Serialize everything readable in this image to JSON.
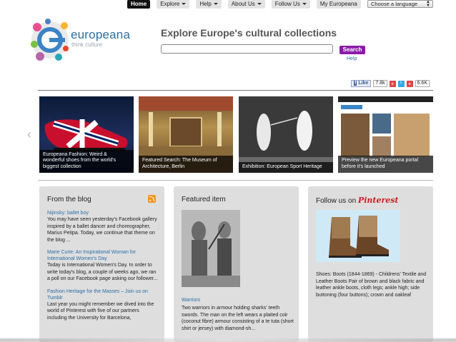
{
  "nav": {
    "items": [
      {
        "label": "Home",
        "active": true,
        "dropdown": false
      },
      {
        "label": "Explore",
        "active": false,
        "dropdown": true
      },
      {
        "label": "Help",
        "active": false,
        "dropdown": true
      },
      {
        "label": "About Us",
        "active": false,
        "dropdown": true
      },
      {
        "label": "Follow Us",
        "active": false,
        "dropdown": true
      },
      {
        "label": "My Europeana",
        "active": false,
        "dropdown": false
      }
    ],
    "language": "Choose a language"
  },
  "brand": {
    "name": "europeana",
    "tagline": "think culture"
  },
  "search": {
    "headline": "Explore Europe's cultural collections",
    "button": "Search",
    "help": "Help",
    "value": ""
  },
  "share": {
    "like": "Like",
    "like_count": "7.8k",
    "plus_count": "6.6K"
  },
  "carousel": [
    {
      "caption": "Europeana Fashion: Weird & wonderful shoes from the world's biggest collection"
    },
    {
      "caption": "Featured Search: The Museum of Architecture, Berlin"
    },
    {
      "caption": "Exhibition: European Sport Heritage"
    },
    {
      "caption": "Preview the new Europeana portal before it's launched"
    }
  ],
  "blog": {
    "title": "From the blog",
    "posts": [
      {
        "title": "Nijinsky: ballet boy",
        "body": "You may have seen yesterday's Facebook gallery inspired by a ballet dancer and choreographer, Marius Petipa. Today, we continue that theme on the blog ..."
      },
      {
        "title": "Marie Curie: An Inspirational Woman for International Women's Day",
        "body": "Today is International Women's Day. In order to write today's blog, a couple of weeks ago, we ran a poll on our Facebook page asking our follower..."
      },
      {
        "title": "Fashion Heritage for the Masses – Join us on Tumblr",
        "body": "Last year you might remember we dived into the world of Pinterest with five of our partners including the University for Barcelona,"
      }
    ]
  },
  "featured": {
    "title": "Featured item",
    "item_title": "Warriors",
    "text": "Two warriors in armour holding sharks' teeth swords. The man on the left wears a plaited coir (coconut fibre) armour consisting of a te tuta (short shirt or jersey) with diamond-sh..."
  },
  "follow": {
    "title": "Follow us on",
    "network": "Pinterest",
    "text": "Shoes: Boots (1844-1869) - Childrens' Textile and Leather Boots Pair of brown and black fabric and leather ankle boots, cloth legs; ankle high; side buttoning (four buttons); crown and oakleaf"
  }
}
